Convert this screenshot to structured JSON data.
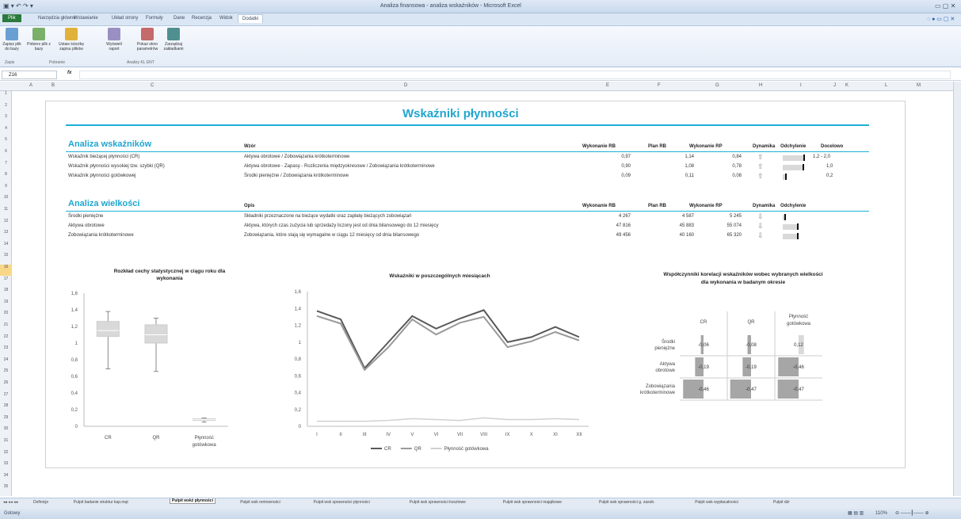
{
  "window": {
    "title": "Analiza finansowa - analiza wskaźników - Microsoft Excel"
  },
  "ribbon": {
    "tabs": [
      "Plik",
      "Narzędzia główne",
      "Wstawianie",
      "Układ strony",
      "Formuły",
      "Dane",
      "Recenzja",
      "Widok",
      "Dodatki"
    ],
    "buttons": [
      "Zapisz plik do bazy",
      "Pobierz plik z bazy",
      "Ustaw ścieżkę zapisu plików",
      "Wyświetl raport",
      "Pokaż okno parametrów",
      "Zarządzaj zakładkami"
    ],
    "groups": [
      "Zapis",
      "Pobranie",
      "Analizy KL ENT"
    ]
  },
  "formula_bar": {
    "name_box": "Z16",
    "fx": "fx",
    "value": ""
  },
  "columns": [
    "A",
    "B",
    "C",
    "D",
    "E",
    "F",
    "G",
    "H",
    "I",
    "J",
    "K",
    "L",
    "M"
  ],
  "rows": [
    "1",
    "2",
    "3",
    "4",
    "5",
    "6",
    "7",
    "8",
    "9",
    "10",
    "11",
    "12",
    "13",
    "14",
    "15",
    "16",
    "17",
    "18",
    "19",
    "20",
    "21",
    "22",
    "23",
    "24",
    "25",
    "26",
    "27",
    "28",
    "29",
    "30",
    "31",
    "32",
    "33",
    "34",
    "35"
  ],
  "selected_row": "16",
  "dashboard": {
    "title": "Wskaźniki płynności",
    "ratios": {
      "section": "Analiza wskaźników",
      "headers": {
        "formula": "Wzór",
        "exec_rb": "Wykonanie RB",
        "plan_rb": "Plan RB",
        "exec_rp": "Wykonanie RP",
        "dynamics": "Dynamika",
        "deviation": "Odchylenie",
        "target": "Docelowo"
      },
      "rows": [
        {
          "name": "Wskaźnik bieżącej płynności (CR)",
          "formula": "Aktywa obrotowe / Zobowiązania krótkoterminowe",
          "exec_rb": "0,97",
          "plan_rb": "1,14",
          "exec_rp": "0,84",
          "target": "1,2 - 2,0",
          "deviation": 0.85
        },
        {
          "name": "Wskaźnik płynności wysokiej tzw. szybki (QR)",
          "formula": "Aktywa obrotowe - Zapasy - Rozliczenia międzyokresowe / Zobowiązania krótkoterminowe",
          "exec_rb": "0,90",
          "plan_rb": "1,08",
          "exec_rp": "0,78",
          "target": "1,0",
          "deviation": 0.83
        },
        {
          "name": "Wskaźnik płynności gotówkowej",
          "formula": "Środki pieniężne / Zobowiązania krótkoterminowe",
          "exec_rb": "0,09",
          "plan_rb": "0,11",
          "exec_rp": "0,08",
          "target": "0,2",
          "deviation": 0.1
        }
      ]
    },
    "values": {
      "section": "Analiza wielkości",
      "headers": {
        "description": "Opis",
        "exec_rb": "Wykonanie RB",
        "plan_rb": "Plan RB",
        "exec_rp": "Wykonanie RP",
        "dynamics": "Dynamika",
        "deviation": "Odchylenie"
      },
      "rows": [
        {
          "name": "Środki pieniężne",
          "description": "Składniki przeznaczone na bieżące wydatki oraz zapłatę bieżących zobowiązań",
          "exec_rb": "4 267",
          "plan_rb": "4 587",
          "exec_rp": "5 245",
          "deviation": 0.05
        },
        {
          "name": "Aktywa obrotowe",
          "description": "Aktywa, których czas zużycia lub sprzedaży liczony jest od dnia bilansowego do 12 miesięcy",
          "exec_rb": "47 816",
          "plan_rb": "45 883",
          "exec_rp": "55 074",
          "deviation": 0.6
        },
        {
          "name": "Zobowiązania krótkoterminowe",
          "description": "Zobowiązania, które stają się wymagalne w ciągu 12 miesięcy od dnia bilansowego",
          "exec_rb": "49 456",
          "plan_rb": "40 160",
          "exec_rp": "65 320",
          "deviation": 0.6
        }
      ]
    }
  },
  "chart_data": [
    {
      "type": "box",
      "title": "Rozkład cechy statystycznej w ciągu roku dla wykonania",
      "categories": [
        "CR",
        "QR",
        "Płynność gotówkowa"
      ],
      "ylim": [
        0,
        1.6
      ],
      "yticks": [
        "0",
        "0,2",
        "0,4",
        "0,6",
        "0,8",
        "1",
        "1,2",
        "1,4",
        "1,6"
      ],
      "boxes": [
        {
          "min": 0.69,
          "q1": 1.08,
          "median": 1.15,
          "q3": 1.26,
          "max": 1.38
        },
        {
          "min": 0.66,
          "q1": 1.0,
          "median": 1.1,
          "q3": 1.22,
          "max": 1.3
        },
        {
          "min": 0.05,
          "q1": 0.07,
          "median": 0.08,
          "q3": 0.09,
          "max": 0.1
        }
      ]
    },
    {
      "type": "line",
      "title": "Wskaźniki w poszczególnych miesiącach",
      "categories": [
        "I",
        "II",
        "III",
        "IV",
        "V",
        "VI",
        "VII",
        "VIII",
        "IX",
        "X",
        "XI",
        "XII"
      ],
      "ylim": [
        0,
        1.6
      ],
      "yticks": [
        "0",
        "0,2",
        "0,4",
        "0,6",
        "0,8",
        "1",
        "1,2",
        "1,4",
        "1,6"
      ],
      "series": [
        {
          "name": "CR",
          "color": "#595959",
          "values": [
            1.37,
            1.27,
            0.69,
            1.0,
            1.31,
            1.16,
            1.28,
            1.38,
            1.0,
            1.06,
            1.18,
            1.06
          ]
        },
        {
          "name": "QR",
          "color": "#9a9a9a",
          "values": [
            1.31,
            1.22,
            0.67,
            0.94,
            1.27,
            1.09,
            1.23,
            1.3,
            0.94,
            1.01,
            1.12,
            1.02
          ]
        },
        {
          "name": "Płynność gotówkowa",
          "color": "#d0d0d0",
          "values": [
            0.06,
            0.06,
            0.06,
            0.07,
            0.09,
            0.08,
            0.07,
            0.1,
            0.08,
            0.08,
            0.09,
            0.08
          ]
        }
      ]
    },
    {
      "type": "heatmap",
      "title": "Współczynniki korelacji wskaźników wobec wybranych wielkości dla wykonania w badanym okresie",
      "columns": [
        "CR",
        "QR",
        "Płynność gotówkowa"
      ],
      "rows": [
        "Środki pieniężne",
        "Aktywa obrotowe",
        "Zobowiązania krótkoterminowe"
      ],
      "values": [
        [
          "-0,06",
          "-0,08",
          "0,12"
        ],
        [
          "-0,19",
          "-0,19",
          "-0,46"
        ],
        [
          "-0,46",
          "-0,47",
          "-0,47"
        ]
      ],
      "numeric": [
        [
          -0.06,
          -0.08,
          0.12
        ],
        [
          -0.19,
          -0.19,
          -0.46
        ],
        [
          -0.46,
          -0.47,
          -0.47
        ]
      ]
    }
  ],
  "sheet_tabs": [
    "Definicje",
    "Pulpit badanie struktur kap.mąt",
    "Pulpit wskż płynności",
    "Pulpit wsk rentowności",
    "Pulpit wsk sprawności płynności",
    "Pulpit wsk sprawności kosztowe",
    "Pulpit wsk sprawności majątkowe",
    "Pulpit wsk sprawności g. zasob.",
    "Pulpit wsk wypłacalności",
    "Pulpit dźr"
  ],
  "active_sheet": 2,
  "status": {
    "ready": "Gotowy",
    "zoom": "110%"
  },
  "colors": {
    "accent": "#1fb0d6",
    "bar": "#d9d9d9"
  }
}
